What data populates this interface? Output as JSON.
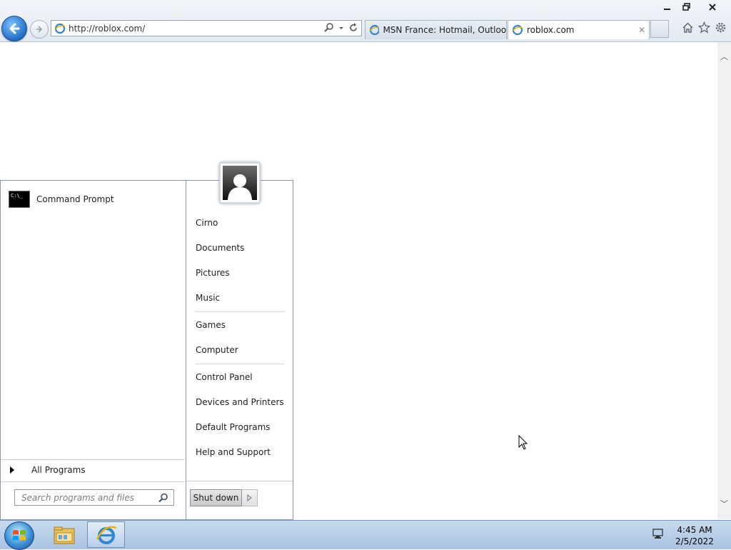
{
  "browser": {
    "address_url": "http://roblox.com/",
    "tabs": [
      {
        "title": "MSN France: Hotmail, Outlook..."
      },
      {
        "title": "roblox.com"
      }
    ]
  },
  "start_menu": {
    "pinned": [
      {
        "label": "Command Prompt"
      }
    ],
    "all_programs": "All Programs",
    "search_placeholder": "Search programs and files",
    "right": {
      "user": "Cirno",
      "documents": "Documents",
      "pictures": "Pictures",
      "music": "Music",
      "games": "Games",
      "computer": "Computer",
      "control_panel": "Control Panel",
      "devices": "Devices and Printers",
      "default_programs": "Default Programs",
      "help": "Help and Support"
    },
    "shutdown": "Shut down"
  },
  "taskbar": {
    "time": "4:45 AM",
    "date": "2/5/2022"
  },
  "colors": {
    "taskbar": "#b7cde8",
    "back_button": "#1f6fc7"
  }
}
